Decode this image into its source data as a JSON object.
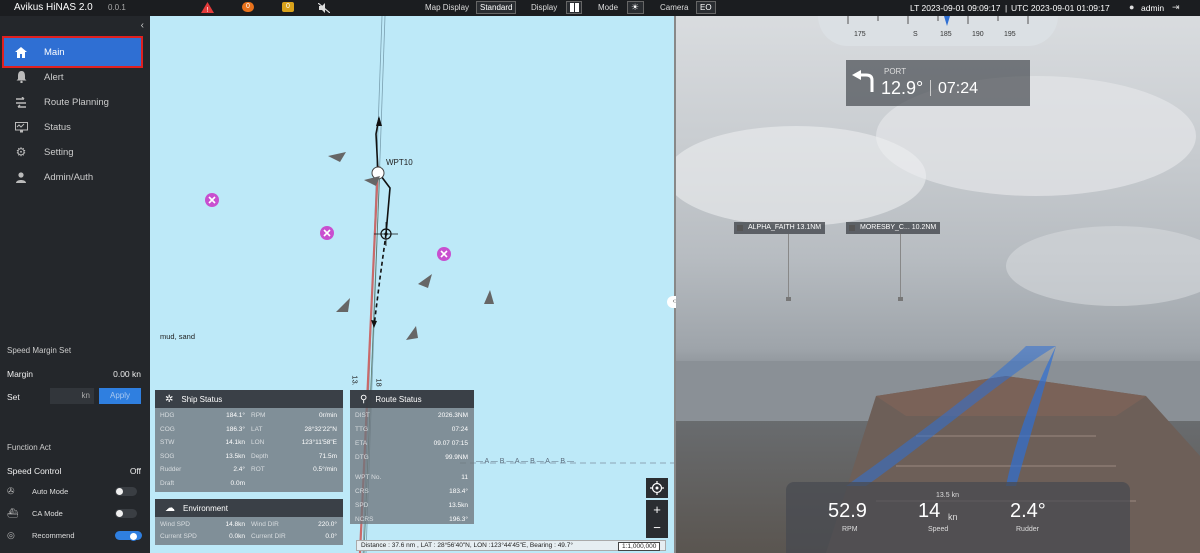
{
  "topbar": {
    "title": "Avikus HiNAS 2.0",
    "version": "0.0.1",
    "alarm_warning": "!",
    "alarm_orange_count": "0",
    "alarm_yellow_count": "0",
    "map_display_label": "Map Display",
    "map_display_value": "Standard",
    "display_label": "Display",
    "mode_label": "Mode",
    "camera_label": "Camera",
    "camera_value": "EO",
    "time_lt": "LT 2023-09-01 09:09:17",
    "time_utc": "UTC 2023-09-01 01:09:17",
    "user": "admin"
  },
  "sidebar": {
    "items": [
      {
        "label": "Main",
        "icon": "home-icon"
      },
      {
        "label": "Alert",
        "icon": "bell-icon"
      },
      {
        "label": "Route Planning",
        "icon": "route-icon"
      },
      {
        "label": "Status",
        "icon": "monitor-icon"
      },
      {
        "label": "Setting",
        "icon": "gear-icon"
      },
      {
        "label": "Admin/Auth",
        "icon": "user-icon"
      }
    ],
    "speed_margin_title": "Speed Margin Set",
    "margin_label": "Margin",
    "margin_value": "0.00 kn",
    "set_label": "Set",
    "set_unit": "kn",
    "apply_label": "Apply",
    "function_act_title": "Function Act",
    "speed_control_label": "Speed Control",
    "speed_control_value": "Off",
    "functions": [
      {
        "label": "Auto Mode",
        "icon": "steering-icon",
        "on": false
      },
      {
        "label": "CA Mode",
        "icon": "ship-icon",
        "on": false
      },
      {
        "label": "Recommend",
        "icon": "binoculars-icon",
        "on": true
      }
    ]
  },
  "map": {
    "waypoint_label": "WPT10",
    "seabed_label": "mud, sand",
    "depth_a": "13.",
    "depth_b": "18",
    "boundary_marks": "— A — B — A — B — A — B —",
    "scalebar_text": "Distance : 37.6 nm , LAT : 28°56'40\"N, LON :123°44'45\"E, Bearing : 49.7°",
    "scale_ratio": "1:1,000,000",
    "zoom_in": "+",
    "zoom_out": "−"
  },
  "ship_status": {
    "title": "Ship Status",
    "rows": [
      {
        "k1": "HDG",
        "v1": "184.1°",
        "k2": "RPM",
        "v2": "0r/min"
      },
      {
        "k1": "COG",
        "v1": "186.3°",
        "k2": "LAT",
        "v2": "28°32'22\"N"
      },
      {
        "k1": "STW",
        "v1": "14.1kn",
        "k2": "LON",
        "v2": "123°11'58\"E"
      },
      {
        "k1": "SOG",
        "v1": "13.5kn",
        "k2": "Depth",
        "v2": "71.5m"
      },
      {
        "k1": "Rudder",
        "v1": "2.4°",
        "k2": "ROT",
        "v2": "0.5°/min"
      },
      {
        "k1": "Draft",
        "v1": "0.0m",
        "k2": "",
        "v2": ""
      }
    ]
  },
  "environment": {
    "title": "Environment",
    "rows": [
      {
        "k1": "Wind SPD",
        "v1": "14.8kn",
        "k2": "Wind DIR",
        "v2": "220.0°"
      },
      {
        "k1": "Current SPD",
        "v1": "0.0kn",
        "k2": "Current DIR",
        "v2": "0.0°"
      }
    ]
  },
  "route_status": {
    "title": "Route Status",
    "rows": [
      {
        "k": "DIST",
        "v": "2026.3NM"
      },
      {
        "k": "TTG",
        "v": "07:24"
      },
      {
        "k": "ETA",
        "v": "09.07 07:15"
      },
      {
        "k": "DTG",
        "v": "99.9NM"
      },
      {
        "k": "WPT No.",
        "v": "11"
      },
      {
        "k": "CRS",
        "v": "183.4°"
      },
      {
        "k": "SPD",
        "v": "13.5kn"
      },
      {
        "k": "NCRS",
        "v": "196.3°"
      }
    ]
  },
  "camera": {
    "compass_ticks": [
      "175",
      "S",
      "185",
      "190",
      "195"
    ],
    "turn_direction": "PORT",
    "turn_angle": "12.9°",
    "turn_time": "07:24",
    "targets": [
      {
        "name": "ALPHA_FAITH 13.1NM"
      },
      {
        "name": "MORESBY_C... 10.2NM"
      }
    ],
    "rpm_value": "52.9",
    "rpm_label": "RPM",
    "speed_value": "14",
    "speed_unit": "kn",
    "speed_label": "Speed",
    "speed_set": "13.5 kn",
    "rudder_value": "2.4°",
    "rudder_label": "Rudder"
  }
}
